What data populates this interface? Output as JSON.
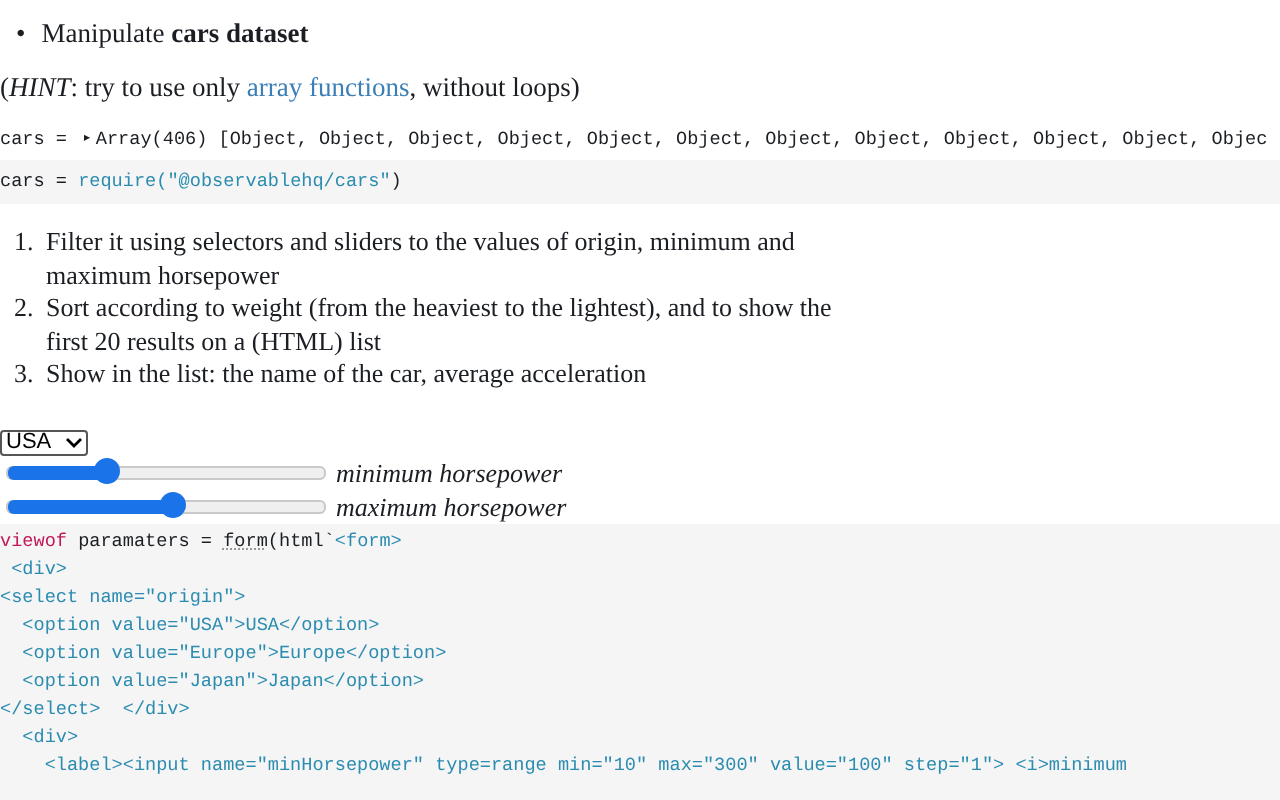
{
  "intro": {
    "bullet": "•",
    "text": "Manipulate **cars dataset**"
  },
  "hint": {
    "before": "(*HINT*: try to use only ",
    "link": "array functions",
    "after": ", without loops)"
  },
  "output": {
    "label": "cars = ",
    "toggle": "▸",
    "value": "Array(406) [Object, Object, Object, Object, Object, Object, Object, Object, Object, Object, Object, Objec"
  },
  "require_cell": {
    "tokens": [
      {
        "text": "cars = ",
        "kind": "plain"
      },
      {
        "text": "require(",
        "kind": "tag"
      },
      {
        "text": "\"@observablehq/cars\"",
        "kind": "tag"
      },
      {
        "text": ")",
        "kind": "plain"
      }
    ]
  },
  "tasks": [
    {
      "number": "1.",
      "text": "Filter it using selectors and sliders to the values of origin, minimum and maximum horsepower"
    },
    {
      "number": "2.",
      "text": "Sort according to weight (from the heaviest to the lightest), and to show the first 20 results on a (HTML) list"
    },
    {
      "number": "3.",
      "text": "Show in the list: the name of the car, average acceleration"
    }
  ],
  "form": {
    "select": {
      "value": "USA"
    },
    "sliders": [
      {
        "label": "minimum horsepower",
        "level": 0.31
      },
      {
        "label": "maximum horsepower",
        "level": 0.52
      }
    ]
  },
  "code": {
    "lines": [
      {
        "tokens": [
          {
            "text": "viewof",
            "kind": "keyword"
          },
          {
            "text": " paramaters = ",
            "kind": "plain"
          },
          {
            "text": "form",
            "kind": "link"
          },
          {
            "text": "(html`",
            "kind": "plain"
          },
          {
            "text": "<form>",
            "kind": "tag"
          }
        ]
      },
      {
        "tokens": [
          {
            "text": " <div>",
            "kind": "tag"
          }
        ]
      },
      {
        "tokens": [
          {
            "text": "<select name=\"origin\">",
            "kind": "tag"
          }
        ]
      },
      {
        "tokens": [
          {
            "text": "  <option value=\"USA\">USA</option>",
            "kind": "tag"
          }
        ]
      },
      {
        "tokens": [
          {
            "text": "  <option value=\"Europe\">Europe</option>",
            "kind": "tag"
          }
        ]
      },
      {
        "tokens": [
          {
            "text": "  <option value=\"Japan\">Japan</option>",
            "kind": "tag"
          }
        ]
      },
      {
        "tokens": [
          {
            "text": "</select>  </div>",
            "kind": "tag"
          }
        ]
      },
      {
        "tokens": [
          {
            "text": "  <div>",
            "kind": "tag"
          }
        ]
      },
      {
        "tokens": [
          {
            "text": "    <label><input name=\"minHorsepower\" type=range min=\"10\" max=\"300\" value=\"100\" step=\"1\"> <i>minimum",
            "kind": "tag"
          }
        ]
      }
    ]
  }
}
